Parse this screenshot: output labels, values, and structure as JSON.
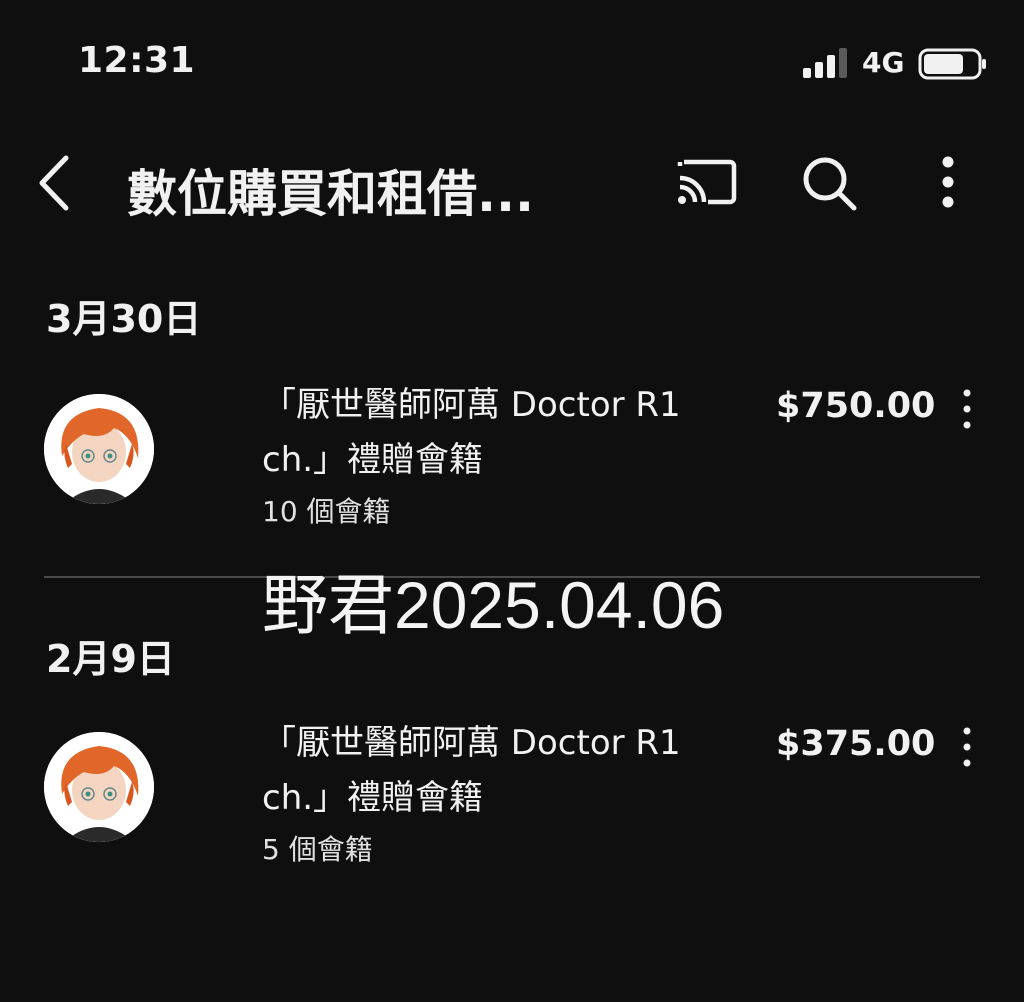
{
  "status_bar": {
    "time": "12:31",
    "network": "4G",
    "signal_level": 3,
    "signal_max": 4,
    "battery_level": 0.75
  },
  "header": {
    "title": "數位購買和租借...",
    "back_icon": "chevron-left-icon",
    "cast_icon": "cast-icon",
    "search_icon": "search-icon",
    "more_icon": "more-vertical-icon"
  },
  "sections": [
    {
      "date": "3月30日",
      "items": [
        {
          "title_line1": "「厭世醫師阿萬 Doctor R1",
          "title_line2": "ch.」禮贈會籍",
          "count": "10 個會籍",
          "price": "$750.00"
        }
      ]
    },
    {
      "date": "2月9日",
      "items": [
        {
          "title_line1": "「厭世醫師阿萬 Doctor R1",
          "title_line2": "ch.」禮贈會籍",
          "count": "5 個會籍",
          "price": "$375.00"
        }
      ]
    }
  ],
  "watermark": "野君2025.04.06",
  "colors": {
    "background": "#0f0f0f",
    "text": "#f1f1f1",
    "divider": "#4a4a4a",
    "avatar_hair": "#e0662a"
  }
}
